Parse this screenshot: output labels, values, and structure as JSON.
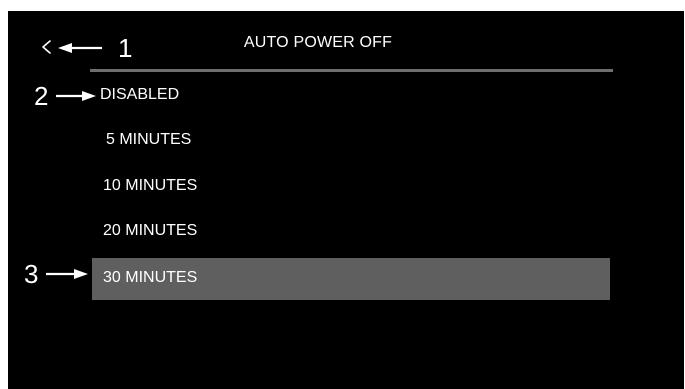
{
  "header": {
    "title": "AUTO POWER OFF",
    "back_icon": "chevron-left-icon"
  },
  "menu": {
    "items": [
      {
        "label": "DISABLED",
        "selected": false
      },
      {
        "label": "5 MINUTES",
        "selected": false
      },
      {
        "label": "10 MINUTES",
        "selected": false
      },
      {
        "label": "20 MINUTES",
        "selected": false
      },
      {
        "label": "30 MINUTES",
        "selected": true
      }
    ]
  },
  "annotations": [
    {
      "number": "1",
      "target": "back-button"
    },
    {
      "number": "2",
      "target": "menu-item-disabled"
    },
    {
      "number": "3",
      "target": "menu-item-30-minutes"
    }
  ],
  "colors": {
    "screen_background": "#000000",
    "text": "#ffffff",
    "divider": "#6e6e6e",
    "selected_background": "#5f5f5f"
  }
}
